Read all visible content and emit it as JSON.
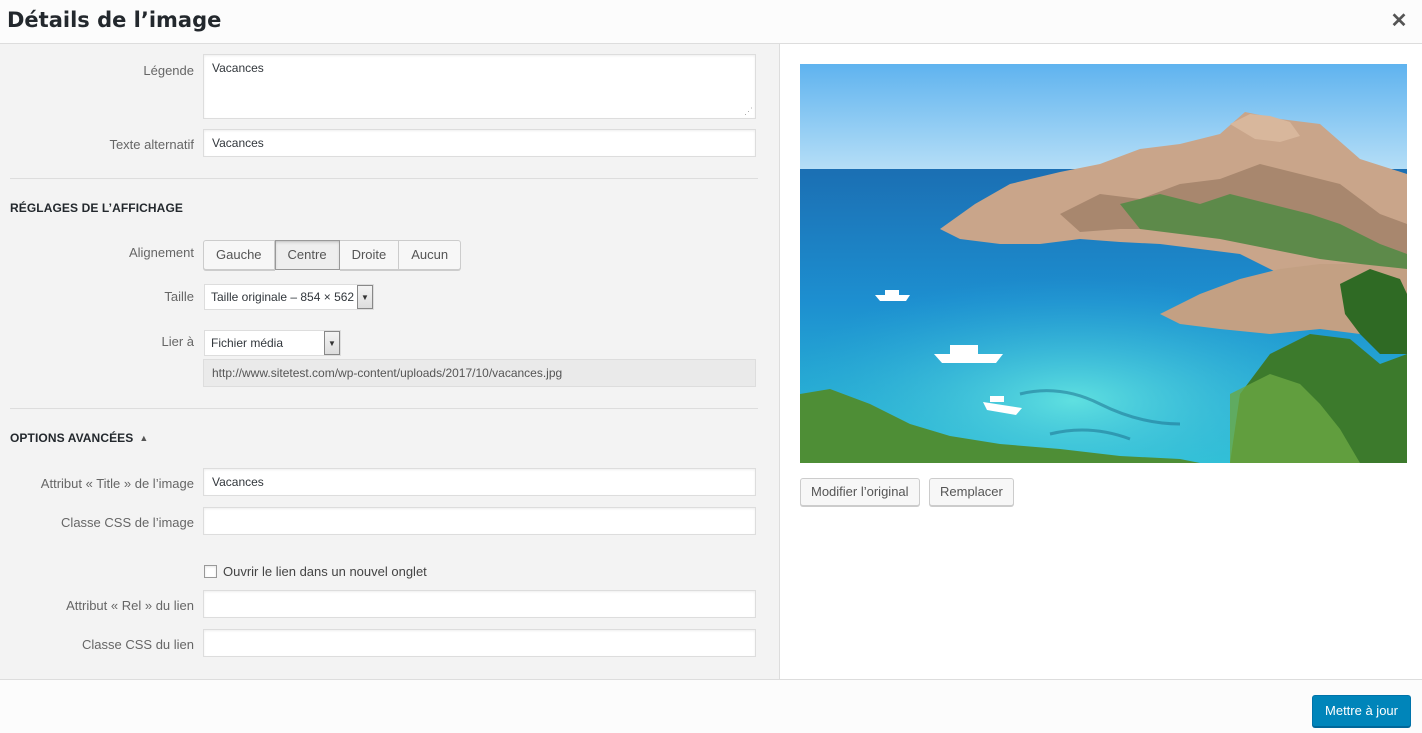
{
  "dialog": {
    "title": "Détails de l’image",
    "close_symbol": "✕"
  },
  "caption": {
    "label": "Légende",
    "value": "Vacances"
  },
  "alt_text": {
    "label": "Texte alternatif",
    "value": "Vacances"
  },
  "display_settings": {
    "title": "RÉGLAGES DE L’AFFICHAGE",
    "alignment": {
      "label": "Alignement",
      "options": [
        "Gauche",
        "Centre",
        "Droite",
        "Aucun"
      ],
      "selected": "Centre"
    },
    "size": {
      "label": "Taille",
      "value": "Taille originale – 854 × 562"
    },
    "link_to": {
      "label": "Lier à",
      "value": "Fichier média",
      "url": "http://www.sitetest.com/wp-content/uploads/2017/10/vacances.jpg"
    }
  },
  "advanced": {
    "title": "OPTIONS AVANCÉES",
    "title_attr": {
      "label": "Attribut « Title » de l’image",
      "value": "Vacances"
    },
    "image_css": {
      "label": "Classe CSS de l’image",
      "value": ""
    },
    "new_tab": {
      "label": "Ouvrir le lien dans un nouvel onglet",
      "checked": false
    },
    "rel_attr": {
      "label": "Attribut « Rel » du lien",
      "value": ""
    },
    "link_css": {
      "label": "Classe CSS du lien",
      "value": ""
    }
  },
  "preview": {
    "edit_button": "Modifier l’original",
    "replace_button": "Remplacer"
  },
  "footer": {
    "update_button": "Mettre à jour"
  },
  "colors": {
    "primary": "#0085ba",
    "panel_bg": "#f3f3f3",
    "border": "#dddddd"
  }
}
